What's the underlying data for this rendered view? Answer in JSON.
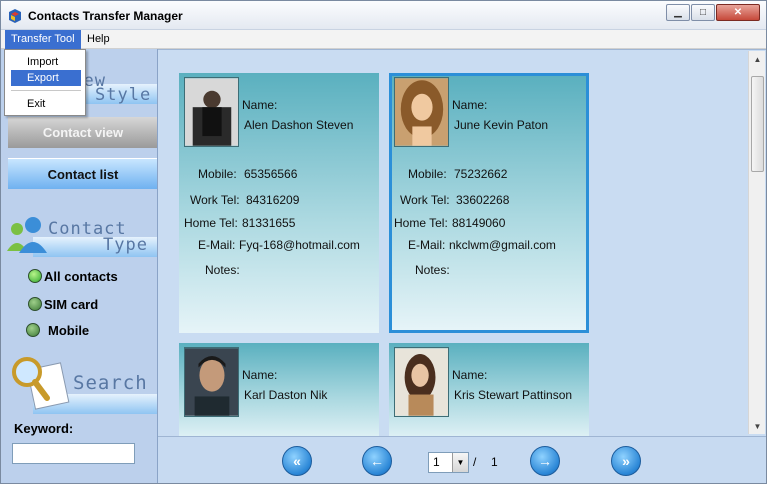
{
  "window": {
    "title": "Contacts Transfer Manager",
    "minimize_icon": "minimize-icon",
    "maximize_icon": "maximize-icon",
    "close_icon": "close-icon"
  },
  "menubar": {
    "items": [
      "Transfer Tool",
      "Help"
    ],
    "open_menu": "Transfer Tool",
    "dropdown": [
      "Import",
      "Export",
      "Exit"
    ],
    "highlighted": "Export"
  },
  "sidebar": {
    "view_style": {
      "word1": "View",
      "word2": "Style",
      "icon": "view-style-icon"
    },
    "view_buttons": [
      "Contact view",
      "Contact list"
    ],
    "contact_type": {
      "word1": "Contact",
      "word2": "Type",
      "icon": "contacts-people-icon"
    },
    "types": [
      "All contacts",
      "SIM card",
      "Mobile"
    ],
    "search": {
      "word": "Search",
      "icon": "search-magnifier-icon"
    },
    "keyword_label": "Keyword:",
    "keyword_value": ""
  },
  "contacts": [
    {
      "name_label": "Name:",
      "name": "Alen Dashon Steven",
      "mobile_label": "Mobile:",
      "mobile": "65356566",
      "work_label": "Work Tel:",
      "work": "84316209",
      "home_label": "Home Tel:",
      "home": "81331655",
      "email_label": "E-Mail:",
      "email": "Fyq-168@hotmail.com",
      "notes_label": "Notes:",
      "selected": false
    },
    {
      "name_label": "Name:",
      "name": "June Kevin Paton",
      "mobile_label": "Mobile:",
      "mobile": "75232662",
      "work_label": "Work Tel:",
      "work": "33602268",
      "home_label": "Home Tel:",
      "home": "88149060",
      "email_label": "E-Mail:",
      "email": "nkclwm@gmail.com",
      "notes_label": "Notes:",
      "selected": true
    },
    {
      "name_label": "Name:",
      "name": "Karl Daston Nik",
      "selected": false
    },
    {
      "name_label": "Name:",
      "name": "Kris Stewart Pattinson",
      "selected": false
    }
  ],
  "pager": {
    "current_page": "1",
    "separator": "/",
    "total_pages": "1",
    "buttons": [
      "first-page-icon",
      "previous-page-icon",
      "next-page-icon",
      "last-page-icon"
    ]
  },
  "colors": {
    "accent": "#3a6fd0",
    "card_top": "#5ab0bf",
    "selected_border": "#2b8fd8",
    "sidebar_bg": "#bcd0ec"
  }
}
